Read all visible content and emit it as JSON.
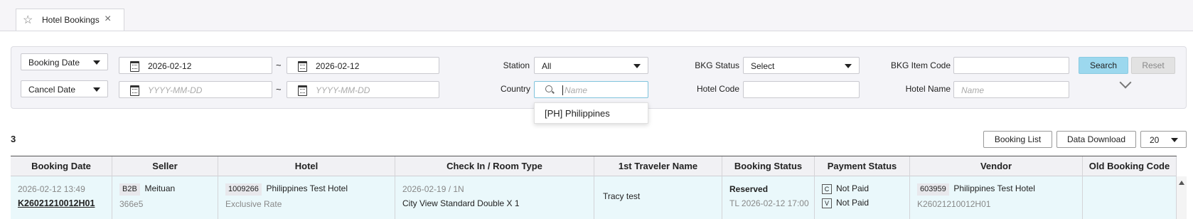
{
  "tab": {
    "title": "Hotel Bookings",
    "star_icon": "star-icon",
    "close_icon": "close-icon"
  },
  "filters": {
    "row1": {
      "date_type": "Booking Date",
      "from": "2026-02-12",
      "to": "2026-02-12"
    },
    "row2": {
      "date_type": "Cancel Date",
      "from_placeholder": "YYYY-MM-DD",
      "to_placeholder": "YYYY-MM-DD"
    },
    "tilde": "~",
    "station_label": "Station",
    "station_value": "All",
    "country_label": "Country",
    "country_placeholder": "Name",
    "bkg_status_label": "BKG Status",
    "bkg_status_value": "Select",
    "hotel_code_label": "Hotel Code",
    "bkg_item_code_label": "BKG Item Code",
    "hotel_name_label": "Hotel Name",
    "hotel_name_placeholder": "Name",
    "search_label": "Search",
    "reset_label": "Reset",
    "country_option": "[PH] Philippines"
  },
  "results": {
    "count": "3",
    "booking_list_label": "Booking List",
    "data_download_label": "Data Download",
    "page_size": "20"
  },
  "table": {
    "headers": [
      "Booking Date",
      "Seller",
      "Hotel",
      "Check In / Room Type",
      "1st Traveler Name",
      "Booking Status",
      "Payment Status",
      "Vendor",
      "Old Booking Code"
    ],
    "rows": [
      {
        "booking_date": "2026-02-12 13:49",
        "booking_code": "K26021210012H01",
        "seller_tag": "B2B",
        "seller_name": "Meituan",
        "seller_sub": "366e5",
        "hotel_code": "1009266",
        "hotel_name": "Philippines Test Hotel",
        "hotel_rate": "Exclusive Rate",
        "checkin": "2026-02-19 / 1N",
        "room_type": "City View Standard Double X 1",
        "traveler": "Tracy test",
        "status": "Reserved",
        "tl": "TL 2026-02-12 17:00",
        "pay_c_tag": "C",
        "pay_c": "Not Paid",
        "pay_v_tag": "V",
        "pay_v": "Not Paid",
        "vendor_code": "603959",
        "vendor_name": "Philippines Test Hotel",
        "vendor_ref": "K26021210012H01",
        "old_code": ""
      }
    ]
  }
}
